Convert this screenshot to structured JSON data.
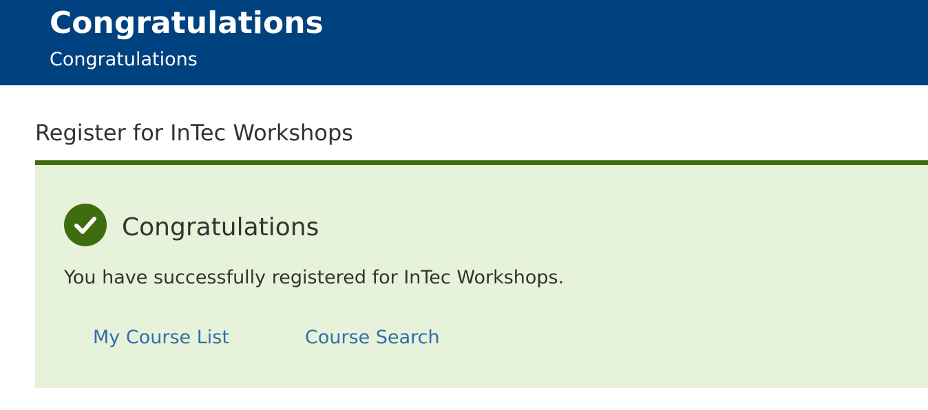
{
  "header": {
    "title": "Congratulations",
    "subtitle": "Congratulations",
    "background_color": "#004280"
  },
  "main": {
    "section_heading": "Register for InTec Workshops"
  },
  "alert": {
    "icon": "check-circle-icon",
    "title": "Congratulations",
    "message": "You have successfully registered for InTec Workshops.",
    "background_color": "#e7f2da",
    "accent_color": "#3e6c0f",
    "links": {
      "course_list": "My Course List",
      "course_search": "Course Search"
    },
    "link_color": "#2f6ea7"
  }
}
